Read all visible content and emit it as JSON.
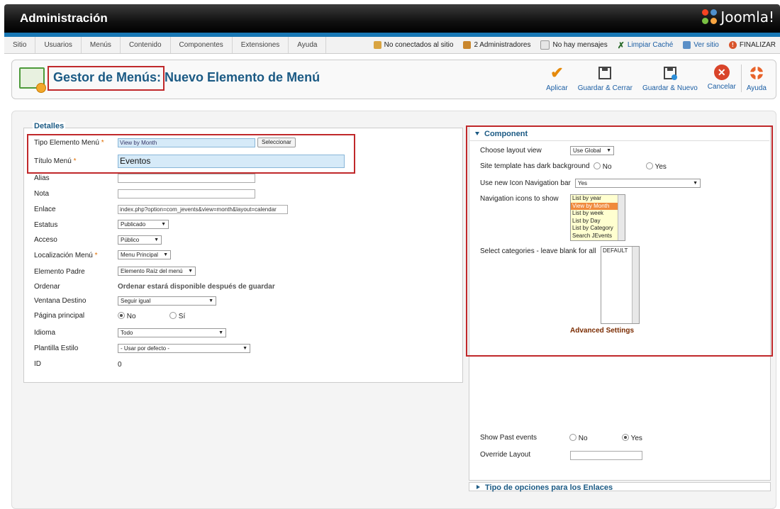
{
  "header": {
    "title": "Administración",
    "brand": "Joomla!"
  },
  "menu": [
    "Sitio",
    "Usuarios",
    "Menús",
    "Contenido",
    "Componentes",
    "Extensiones",
    "Ayuda"
  ],
  "status": {
    "not_connected": "No conectados al sitio",
    "admins": "2 Administradores",
    "messages": "No hay mensajes",
    "clear_cache": "Limpiar Caché",
    "view_site": "Ver sitio",
    "logout": "FINALIZAR"
  },
  "page": {
    "title_part1": "Gestor de Menús",
    "title_part2": ": Nuevo Elemento de Menú"
  },
  "toolbar": {
    "apply": "Aplicar",
    "save_close": "Guardar & Cerrar",
    "save_new": "Guardar & Nuevo",
    "cancel": "Cancelar",
    "help": "Ayuda"
  },
  "details": {
    "legend": "Detalles",
    "type_label": "Tipo Elemento Menú",
    "type_value": "View by Month",
    "select_btn": "Seleccionar",
    "title_label": "Título Menú",
    "title_value": "Eventos",
    "alias_label": "Alias",
    "note_label": "Nota",
    "link_label": "Enlace",
    "link_value": "index.php?option=com_jevents&view=month&layout=calendar",
    "status_label": "Estatus",
    "status_value": "Publicado",
    "access_label": "Acceso",
    "access_value": "Público",
    "location_label": "Localización Menú",
    "location_value": "Menu Principal",
    "parent_label": "Elemento Padre",
    "parent_value": "Elemento Raíz del menú",
    "order_label": "Ordenar",
    "order_value": "Ordenar estará disponible después de guardar",
    "target_label": "Ventana Destino",
    "target_value": "Seguir igual",
    "home_label": "Página principal",
    "home_no": "No",
    "home_yes": "Sí",
    "lang_label": "Idioma",
    "lang_value": "Todo",
    "style_label": "Plantilla Estilo",
    "style_value": "- Usar por defecto -",
    "id_label": "ID",
    "id_value": "0"
  },
  "component": {
    "title": "Component",
    "layout_label": "Choose layout view",
    "layout_value": "Use Global",
    "dark_label": "Site template has dark background",
    "no": "No",
    "yes": "Yes",
    "iconbar_label": "Use new Icon Navigation bar",
    "iconbar_value": "Yes",
    "navicons_label": "Navigation icons to show",
    "navicons": [
      "List by year",
      "View by Month",
      "List by week",
      "List by Day",
      "List by Category",
      "Search JEvents"
    ],
    "categories_label": "Select categories - leave blank for all",
    "categories": [
      "DEFAULT"
    ],
    "advanced": "Advanced Settings",
    "past_label": "Show Past events",
    "override_label": "Override Layout"
  },
  "next_section": "Tipo de opciones para los Enlaces"
}
